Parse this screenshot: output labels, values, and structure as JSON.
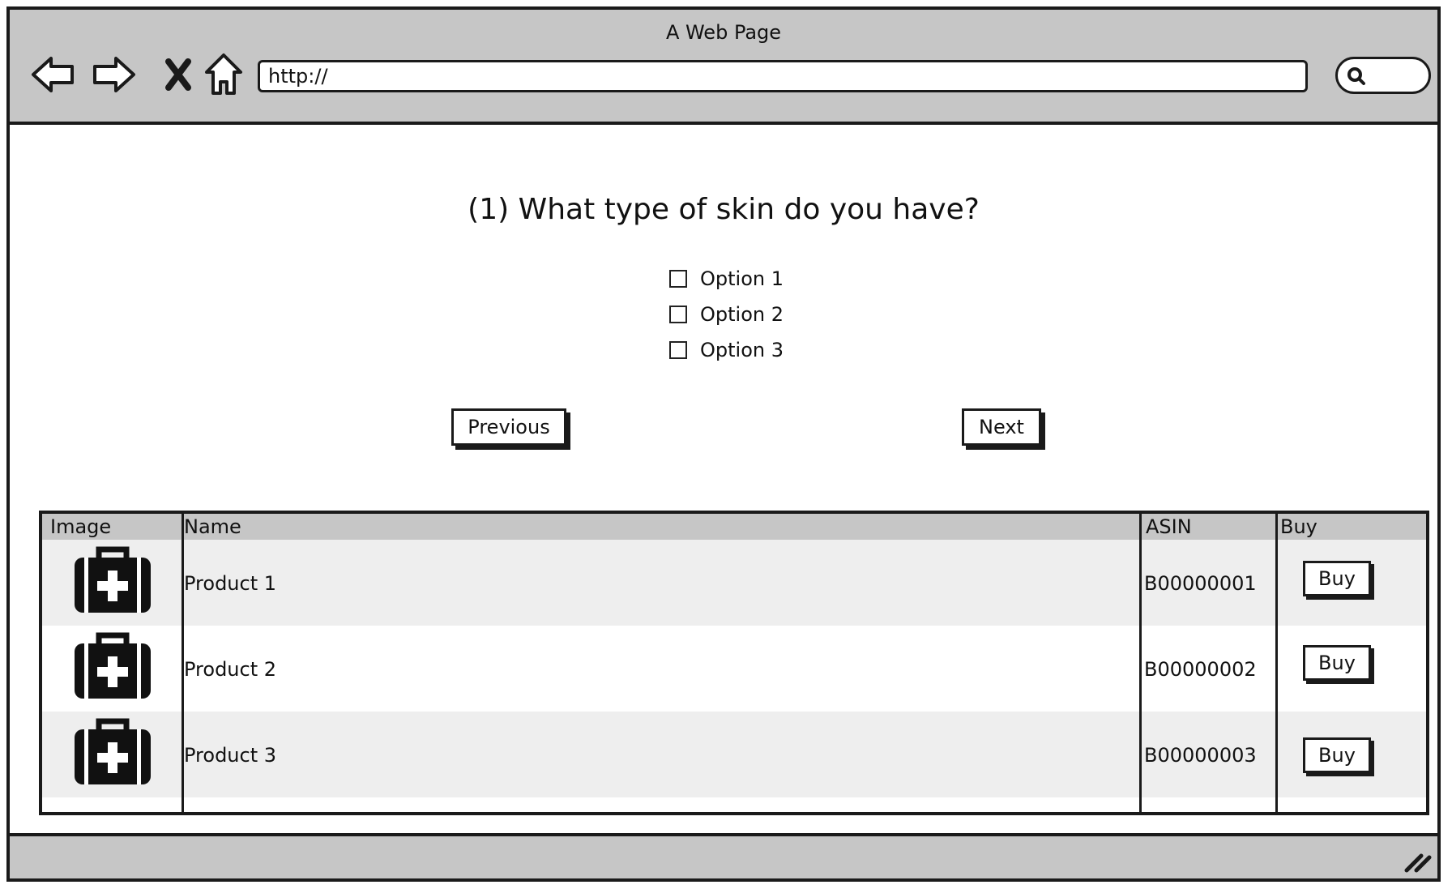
{
  "window": {
    "title": "A Web Page",
    "url": "http://"
  },
  "icons": {
    "back": "back-arrow-icon",
    "forward": "forward-arrow-icon",
    "stop": "stop-icon",
    "home": "home-icon",
    "search": "search-icon",
    "product_image": "medical-kit-icon",
    "resize": "resize-grip-icon"
  },
  "quiz": {
    "question": "(1) What type of skin do you have?",
    "options": [
      "Option 1",
      "Option 2",
      "Option 3"
    ],
    "previous_label": "Previous",
    "next_label": "Next"
  },
  "table": {
    "headers": [
      "Image",
      "Name",
      "ASIN",
      "Buy"
    ],
    "rows": [
      {
        "name": "Product 1",
        "asin": "B00000001",
        "buy_label": "Buy"
      },
      {
        "name": "Product 2",
        "asin": "B00000002",
        "buy_label": "Buy"
      },
      {
        "name": "Product 3",
        "asin": "B00000003",
        "buy_label": "Buy"
      }
    ]
  },
  "colors": {
    "chrome": "#c6c6c6",
    "row_shade": "#eeeeee",
    "border": "#1a1a1a"
  }
}
